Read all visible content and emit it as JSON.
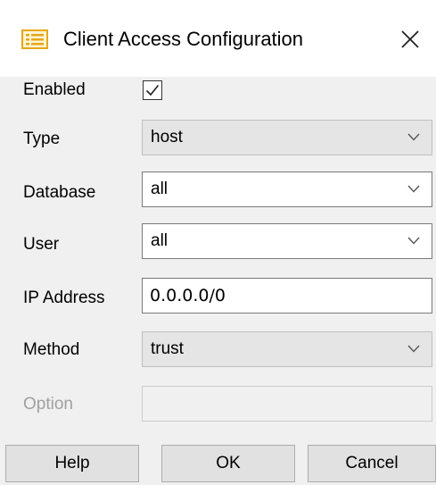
{
  "window": {
    "title": "Client Access Configuration",
    "title_icon": "list-document-icon",
    "close_icon": "close-icon"
  },
  "form": {
    "enabled": {
      "label": "Enabled",
      "checked": true
    },
    "type": {
      "label": "Type",
      "value": "host"
    },
    "database": {
      "label": "Database",
      "value": "all"
    },
    "user": {
      "label": "User",
      "value": "all"
    },
    "ip_address": {
      "label": "IP Address",
      "value": "0.0.0.0/0"
    },
    "method": {
      "label": "Method",
      "value": "trust"
    },
    "option": {
      "label": "Option",
      "value": ""
    }
  },
  "buttons": {
    "help": "Help",
    "ok": "OK",
    "cancel": "Cancel"
  },
  "colors": {
    "icon_accent": "#e6a817",
    "disabled_text": "#a0a0a0"
  }
}
